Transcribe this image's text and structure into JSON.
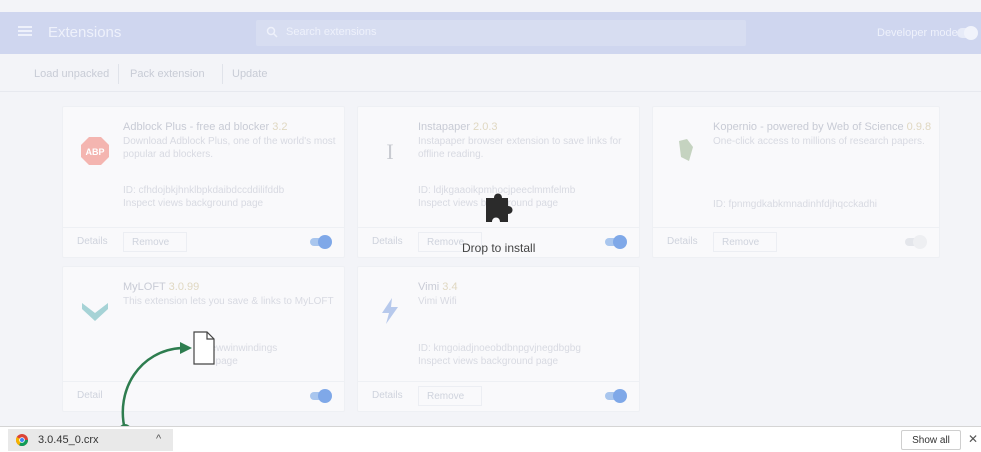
{
  "header": {
    "title": "Extensions",
    "search_placeholder": "Search extensions",
    "developer_mode_label": "Developer mode"
  },
  "toolbar": {
    "load_unpacked": "Load unpacked",
    "pack_extension": "Pack extension",
    "update": "Update"
  },
  "extensions": [
    {
      "name": "Adblock Plus - free ad blocker",
      "version": "3.2",
      "description": "Download Adblock Plus, one of the world's most popular ad blockers.",
      "id": "ID: cfhdojbkjhnklbpkdaibdccddilifddb",
      "inspect": "Inspect views background page",
      "details": "Details",
      "remove": "Remove",
      "enabled": true
    },
    {
      "name": "Instapaper",
      "version": "2.0.3",
      "description": "Instapaper browser extension to save links for offline reading.",
      "id": "ID: ldjkgaaoikpmhocjpeeclmmfelmb",
      "inspect": "Inspect views background page",
      "details": "Details",
      "remove": "Remove",
      "enabled": true
    },
    {
      "name": "Kopernio - powered by Web of Science",
      "version": "0.9.8",
      "description": "One-click access to millions of research papers.",
      "id": "ID: fpnmgdkabkmnadinhfdjhqcckadhi",
      "inspect": "",
      "details": "Details",
      "remove": "Remove",
      "enabled": false
    },
    {
      "name": "MyLOFT",
      "version": "3.0.99",
      "description": "This extension lets you save & links to MyLOFT",
      "id": "newwinwindings",
      "inspect": "ul page",
      "details": "Detail",
      "remove": "",
      "enabled": true
    },
    {
      "name": "Vimi",
      "version": "3.4",
      "description": "Vimi Wifi",
      "id": "ID: kmgoiadjnoeobdbnpgvjnegdbgbg",
      "inspect": "Inspect views background page",
      "details": "Details",
      "remove": "Remove",
      "enabled": true
    }
  ],
  "drop_overlay": {
    "label": "Drop to install"
  },
  "download_bar": {
    "file_name": "3.0.45_0.crx",
    "chevron": "^",
    "show_all": "Show all",
    "close": "✕"
  },
  "colors": {
    "header": "#cfd6ef",
    "accent_green": "#2e7d4f",
    "toggle_on": "#7fa8e8"
  }
}
